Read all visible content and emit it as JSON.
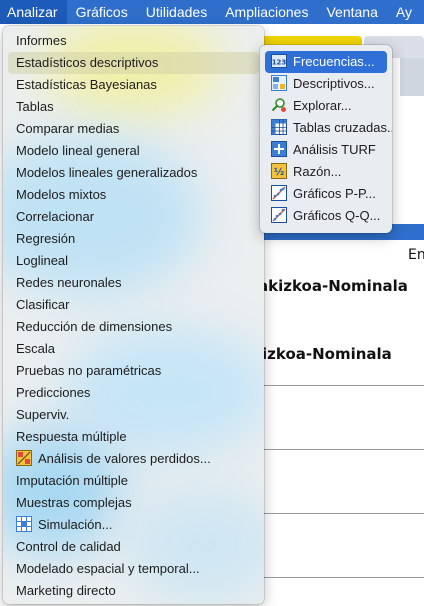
{
  "menubar": {
    "items": [
      "Analizar",
      "Gráficos",
      "Utilidades",
      "Ampliaciones",
      "Ventana",
      "Ay"
    ]
  },
  "background": {
    "heading_1": "akizkoa-Nominala",
    "heading_2": "izkoa-Nominala",
    "side_text": "En"
  },
  "analyze_menu": {
    "items": [
      {
        "label": "Informes"
      },
      {
        "label": "Estadísticos descriptivos",
        "has_submenu": true,
        "highlighted": true
      },
      {
        "label": "Estadísticas Bayesianas"
      },
      {
        "label": "Tablas"
      },
      {
        "label": "Comparar medias"
      },
      {
        "label": "Modelo lineal general"
      },
      {
        "label": "Modelos lineales generalizados"
      },
      {
        "label": "Modelos mixtos"
      },
      {
        "label": "Correlacionar"
      },
      {
        "label": "Regresión"
      },
      {
        "label": "Loglineal"
      },
      {
        "label": "Redes neuronales"
      },
      {
        "label": "Clasificar"
      },
      {
        "label": "Reducción de dimensiones"
      },
      {
        "label": "Escala"
      },
      {
        "label": "Pruebas no paramétricas"
      },
      {
        "label": "Predicciones"
      },
      {
        "label": "Superviv."
      },
      {
        "label": "Respuesta múltiple"
      },
      {
        "label": "Análisis de valores perdidos...",
        "icon": "missing-values-icon"
      },
      {
        "label": "Imputación múltiple"
      },
      {
        "label": "Muestras complejas"
      },
      {
        "label": "Simulación...",
        "icon": "simulation-icon"
      },
      {
        "label": "Control de calidad"
      },
      {
        "label": "Modelado espacial y temporal..."
      },
      {
        "label": "Marketing directo"
      }
    ]
  },
  "descriptive_submenu": {
    "items": [
      {
        "label": "Frecuencias...",
        "icon": "frequencies-icon",
        "selected": true
      },
      {
        "label": "Descriptivos...",
        "icon": "descriptives-icon"
      },
      {
        "label": "Explorar...",
        "icon": "explore-icon"
      },
      {
        "label": "Tablas cruzadas...",
        "icon": "crosstabs-icon"
      },
      {
        "label": "Análisis TURF",
        "icon": "turf-icon"
      },
      {
        "label": "Razón...",
        "icon": "ratio-icon"
      },
      {
        "label": "Gráficos P-P...",
        "icon": "pp-plot-icon"
      },
      {
        "label": "Gráficos Q-Q...",
        "icon": "qq-plot-icon"
      }
    ]
  },
  "colors": {
    "menubar": "#2f6fcb",
    "selection": "#2f6fd8",
    "highlight": "#d2d2aa"
  }
}
